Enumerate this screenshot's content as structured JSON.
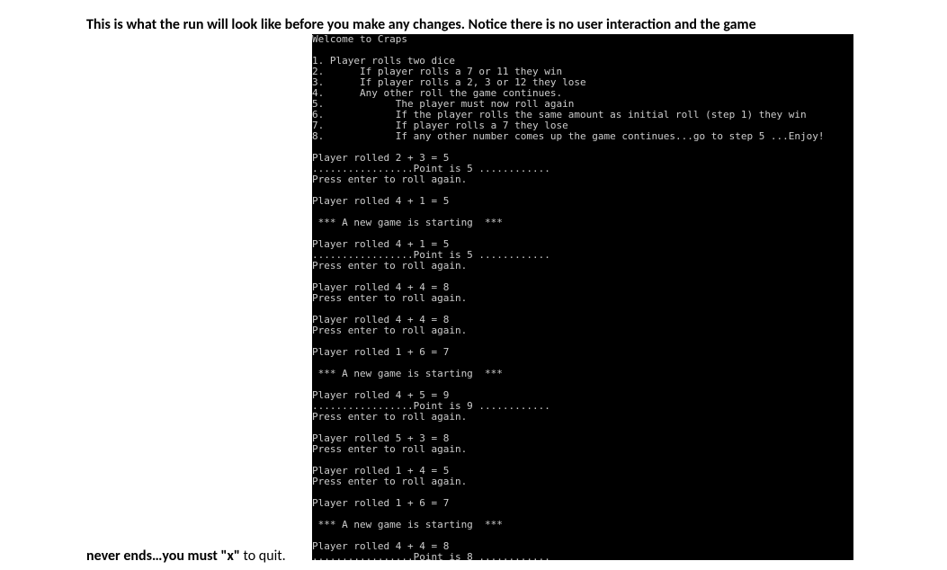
{
  "caption": {
    "top": "This is what the run will look like before you make any changes. Notice there is no user interaction and the game",
    "bottom_bold": "never ends…you must \"x\"",
    "bottom_rest": " to quit."
  },
  "console": {
    "lines": [
      "Welcome to Craps",
      "",
      "1. Player rolls two dice",
      "2.      If player rolls a 7 or 11 they win",
      "3.      If player rolls a 2, 3 or 12 they lose",
      "4.      Any other roll the game continues.",
      "5.            The player must now roll again",
      "6.            If the player rolls the same amount as initial roll (step 1) they win",
      "7.            If player rolls a 7 they lose",
      "8.            If any other number comes up the game continues...go to step 5 ...Enjoy!",
      "",
      "Player rolled 2 + 3 = 5",
      ".................Point is 5 ............",
      "Press enter to roll again.",
      "",
      "Player rolled 4 + 1 = 5",
      "",
      " *** A new game is starting  ***",
      "",
      "Player rolled 4 + 1 = 5",
      ".................Point is 5 ............",
      "Press enter to roll again.",
      "",
      "Player rolled 4 + 4 = 8",
      "Press enter to roll again.",
      "",
      "Player rolled 4 + 4 = 8",
      "Press enter to roll again.",
      "",
      "Player rolled 1 + 6 = 7",
      "",
      " *** A new game is starting  ***",
      "",
      "Player rolled 4 + 5 = 9",
      ".................Point is 9 ............",
      "Press enter to roll again.",
      "",
      "Player rolled 5 + 3 = 8",
      "Press enter to roll again.",
      "",
      "Player rolled 1 + 4 = 5",
      "Press enter to roll again.",
      "",
      "Player rolled 1 + 6 = 7",
      "",
      " *** A new game is starting  ***",
      "",
      "Player rolled 4 + 4 = 8",
      ".................Point is 8 ............"
    ]
  }
}
